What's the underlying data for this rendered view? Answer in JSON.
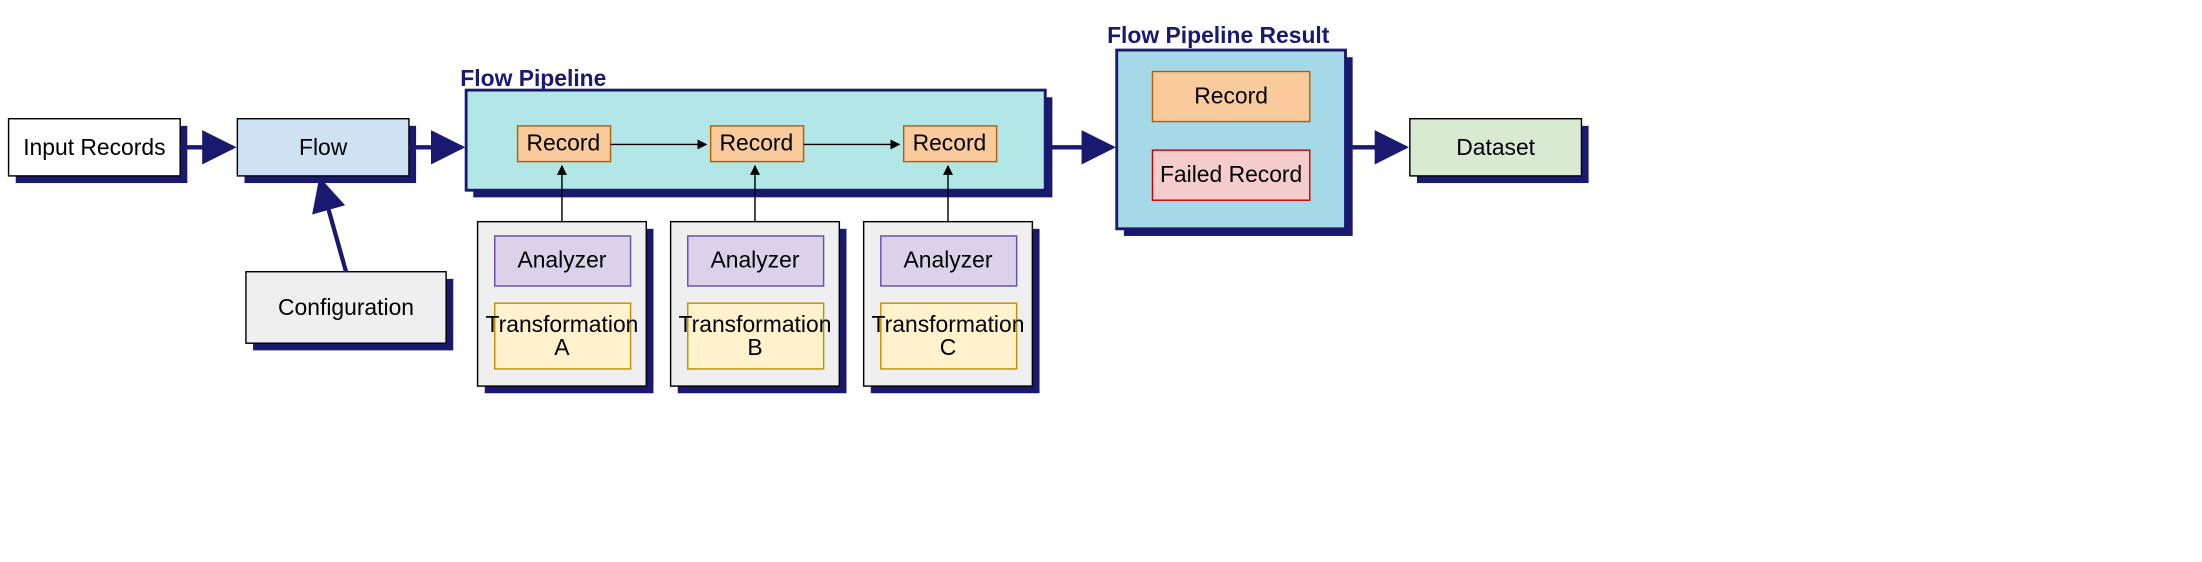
{
  "diagram": {
    "nodes": {
      "inputRecords": {
        "label": "Input Records",
        "fill": "#ffffff",
        "stroke": "#000000"
      },
      "flow": {
        "label": "Flow",
        "fill": "#cfe2f3",
        "stroke": "#000000"
      },
      "configuration": {
        "label": "Configuration",
        "fill": "#efefef",
        "stroke": "#000000"
      },
      "flowPipeline": {
        "title": "Flow Pipeline",
        "fill": "#b3e6e6",
        "stroke": "#191970",
        "records": [
          {
            "label": "Record"
          },
          {
            "label": "Record"
          },
          {
            "label": "Record"
          }
        ],
        "stages": [
          {
            "analyzer": "Analyzer",
            "transformation": "Transformation A"
          },
          {
            "analyzer": "Analyzer",
            "transformation": "Transformation B"
          },
          {
            "analyzer": "Analyzer",
            "transformation": "Transformation C"
          }
        ]
      },
      "flowPipelineResult": {
        "title": "Flow Pipeline Result",
        "fill": "#a6d9e8",
        "stroke": "#191970",
        "record": "Record",
        "failedRecord": "Failed Record"
      },
      "dataset": {
        "label": "Dataset",
        "fill": "#d9ead3",
        "stroke": "#000000"
      }
    },
    "colors": {
      "shadow": "#191970",
      "record": "#f9cb9c",
      "analyzer": "#d9d2e9",
      "transformation": "#fff2cc",
      "failedRecord": "#f4cccc",
      "stageBox": "#efefef"
    }
  }
}
